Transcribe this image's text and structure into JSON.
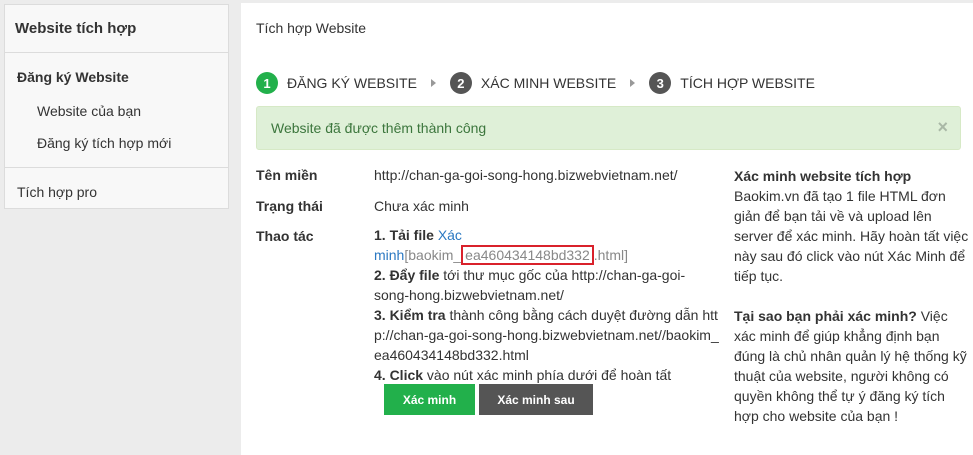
{
  "sidebar": {
    "title": "Website tích hợp",
    "group_title": "Đăng ký Website",
    "items": [
      "Website của bạn",
      "Đăng ký tích hợp mới"
    ],
    "pro": "Tích hợp pro"
  },
  "main": {
    "title": "Tích hợp Website",
    "steps": [
      {
        "num": "1",
        "label": "ĐĂNG KÝ WEBSITE"
      },
      {
        "num": "2",
        "label": "XÁC MINH WEBSITE"
      },
      {
        "num": "3",
        "label": "TÍCH HỢP WEBSITE"
      }
    ],
    "alert": "Website đã được thêm thành công",
    "alert_close": "×",
    "domain_label": "Tên miền",
    "domain_value": "http://chan-ga-goi-song-hong.bizwebvietnam.net/",
    "status_label": "Trạng thái",
    "status_value": "Chưa xác minh",
    "action_label": "Thao tác",
    "instructions": {
      "s1_bold": "1. Tải file",
      "s1_link": "Xác minh",
      "s1_file_open": "[baokim_",
      "s1_file_hash": "ea460434148bd332",
      "s1_file_close": ".html]",
      "s2_bold": "2. Đẩy file",
      "s2_text": " tới thư mục gốc của http://chan-ga-goi-song-hong.bizwebvietnam.net/",
      "s3_bold": "3. Kiểm tra",
      "s3_text": " thành công bằng cách duyệt đường dẫn http://chan-ga-goi-song-hong.bizwebvietnam.net//baokim_ea460434148bd332.html",
      "s4_bold": "4. Click",
      "s4_text": " vào nút xác minh phía dưới để hoàn tất"
    },
    "buttons": {
      "verify": "Xác minh",
      "verify_later": "Xác minh sau"
    },
    "side": {
      "h1": "Xác minh website tích hợp",
      "p1": "Baokim.vn đã tạo 1 file HTML đơn giản để bạn tải về và upload lên server để xác minh. Hãy hoàn tất việc này sau đó click vào nút Xác Minh để tiếp tục.",
      "h2": "Tại sao bạn phải xác minh?",
      "p2": " Việc xác minh để giúp khẳng định bạn đúng là chủ nhân quản lý hệ thống kỹ thuật của website, người không có quyền không thể tự ý đăng ký tích hợp cho website của bạn !"
    }
  },
  "colors": {
    "accent": "#22b04b",
    "dark": "#555555",
    "link": "#2a78c2",
    "highlight": "#d9212b"
  }
}
